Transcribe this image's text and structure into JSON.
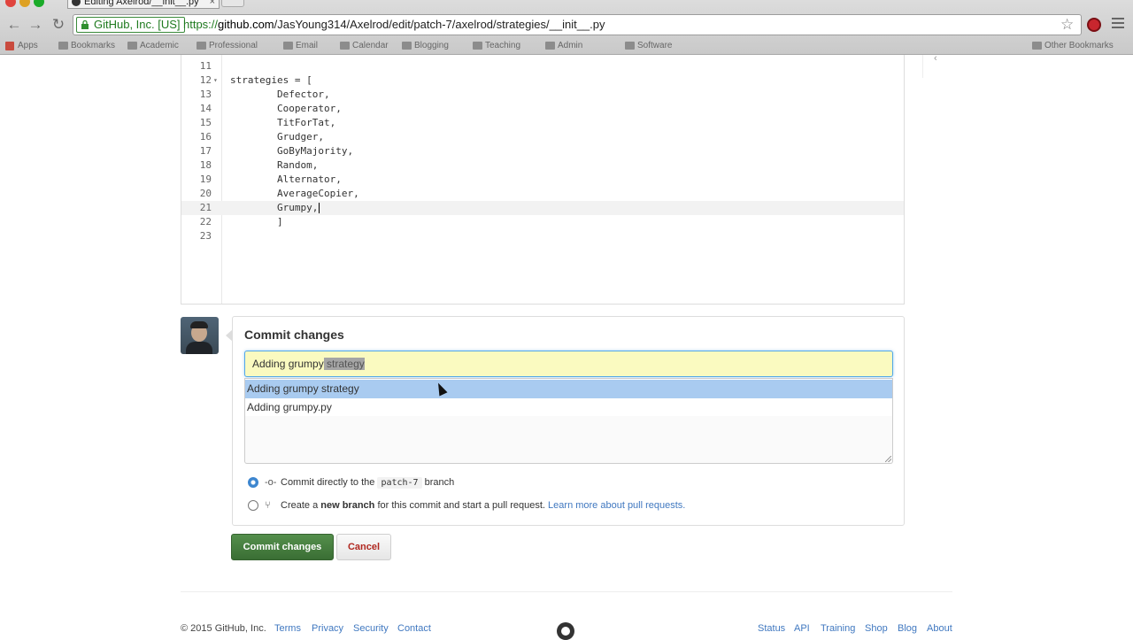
{
  "browser": {
    "tab_title": "Editing Axelrod/__init__.py",
    "ev_label": "GitHub, Inc. [US]",
    "url_scheme": "https://",
    "url_host": "github.com",
    "url_path": "/JasYoung314/Axelrod/edit/patch-7/axelrod/strategies/__init__.py",
    "bookmarks": [
      "Apps",
      "Bookmarks",
      "Academic",
      "Professional",
      "Email",
      "Calendar",
      "Blogging",
      "Teaching",
      "Admin",
      "Software",
      "Other Bookmarks"
    ]
  },
  "editor": {
    "lines": [
      {
        "n": "11",
        "text": ""
      },
      {
        "n": "12",
        "text": "strategies = [",
        "fold": "▾"
      },
      {
        "n": "13",
        "text": "        Defector,"
      },
      {
        "n": "14",
        "text": "        Cooperator,"
      },
      {
        "n": "15",
        "text": "        TitForTat,"
      },
      {
        "n": "16",
        "text": "        Grudger,"
      },
      {
        "n": "17",
        "text": "        GoByMajority,"
      },
      {
        "n": "18",
        "text": "        Random,"
      },
      {
        "n": "19",
        "text": "        Alternator,"
      },
      {
        "n": "20",
        "text": "        AverageCopier,"
      },
      {
        "n": "21",
        "text": "        Grumpy,"
      },
      {
        "n": "22",
        "text": "        ]"
      },
      {
        "n": "23",
        "text": ""
      }
    ],
    "active_line": "21"
  },
  "commit": {
    "title": "Commit changes",
    "summary_typed": "Adding grumpy",
    "summary_selected": " strategy",
    "suggestions": [
      "Adding grumpy strategy",
      "Adding grumpy.py"
    ],
    "option_direct_prefix": "Commit directly to the",
    "branch_name": "patch-7",
    "option_direct_suffix": "branch",
    "option_new_strong": "new branch",
    "option_new_prefix": "Create a",
    "option_new_suffix": "for this commit and start a pull request.",
    "option_new_link": "Learn more about pull requests.",
    "commit_button": "Commit changes",
    "cancel_button": "Cancel"
  },
  "footer": {
    "copyright": "© 2015 GitHub, Inc.",
    "left_links": [
      "Terms",
      "Privacy",
      "Security",
      "Contact"
    ],
    "right_links": [
      "Status",
      "API",
      "Training",
      "Shop",
      "Blog",
      "About"
    ]
  },
  "colors": {
    "commit_button": "#3a6e34",
    "input_highlight": "#fafac0",
    "suggestion_highlight": "#a9cbf0",
    "link": "#4078c0"
  }
}
